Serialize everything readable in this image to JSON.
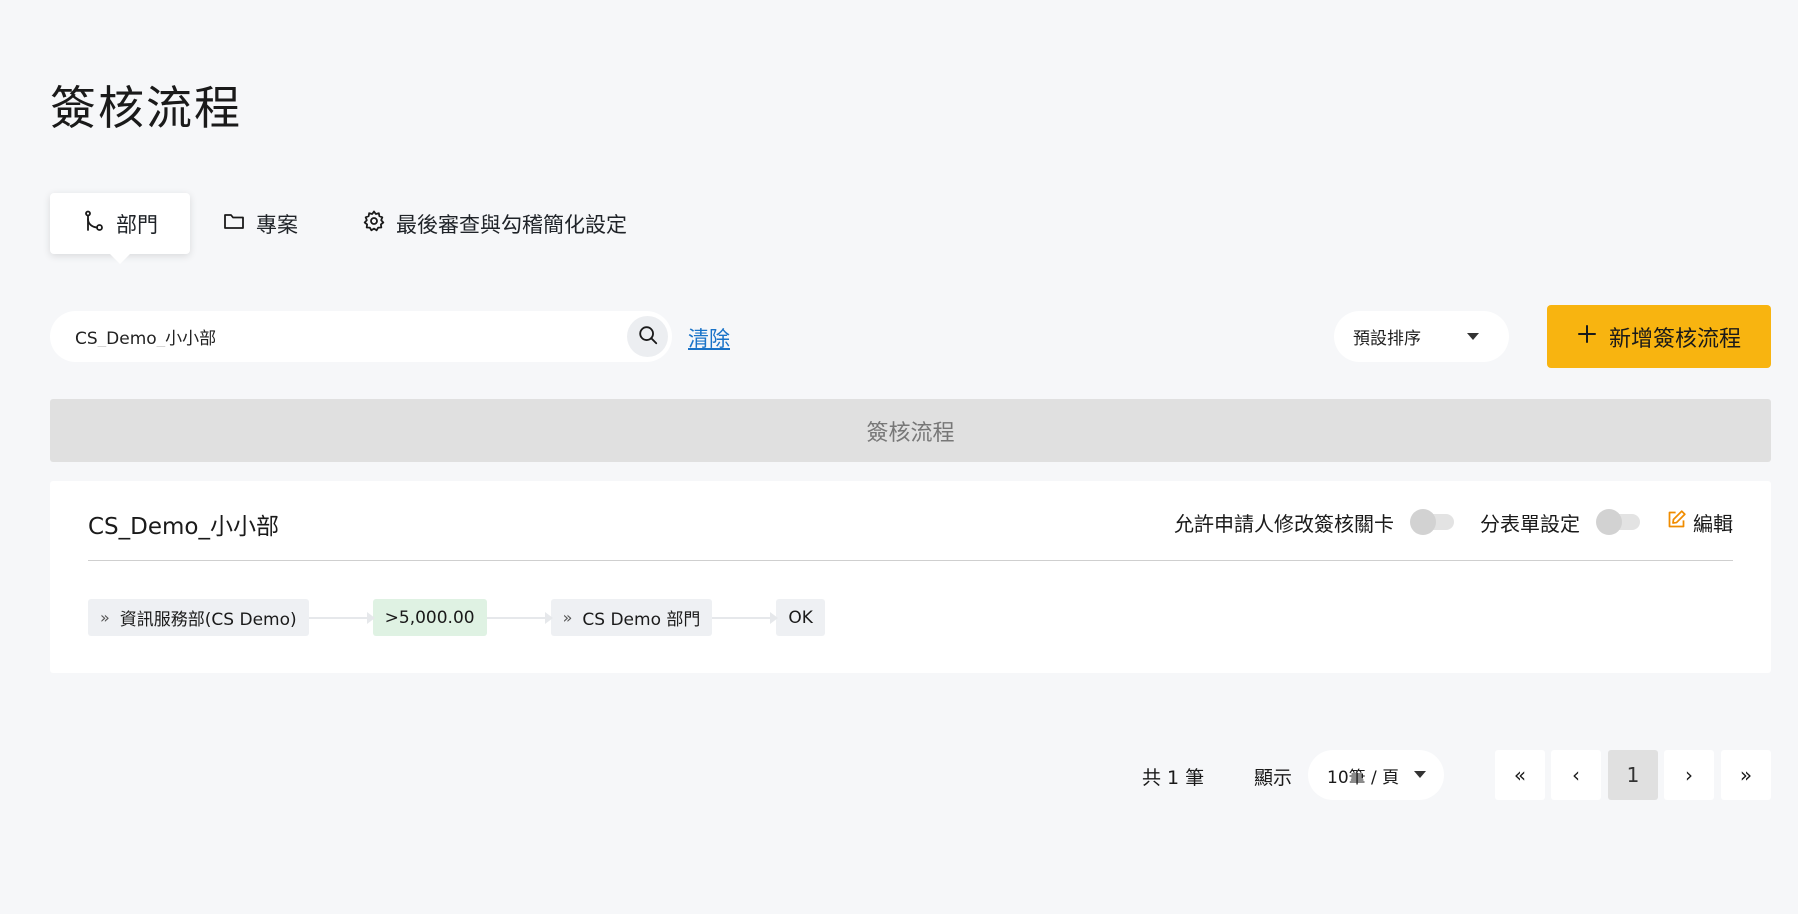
{
  "page": {
    "title": "簽核流程"
  },
  "tabs": [
    {
      "label": "部門",
      "icon": "branch-icon",
      "active": true
    },
    {
      "label": "專案",
      "icon": "folder-icon",
      "active": false
    },
    {
      "label": "最後審查與勾稽簡化設定",
      "icon": "gear-icon",
      "active": false
    }
  ],
  "search": {
    "value": "CS_Demo_小小部",
    "placeholder": "",
    "clear_label": "清除"
  },
  "sort": {
    "selected": "預設排序"
  },
  "toolbar": {
    "add_label": "新增簽核流程",
    "accent": "#f8b410"
  },
  "list": {
    "header": "簽核流程"
  },
  "card": {
    "title": "CS_Demo_小小部",
    "allow_edit_label": "允許申請人修改簽核關卡",
    "split_form_label": "分表單設定",
    "edit_label": "編輯",
    "flow": [
      {
        "type": "dept",
        "label": "資訊服務部(CS Demo)"
      },
      {
        "type": "condition",
        "label": ">5,000.00"
      },
      {
        "type": "dept",
        "label": "CS Demo 部門"
      },
      {
        "type": "end",
        "label": "OK"
      }
    ]
  },
  "pagination": {
    "total": "共 1 筆",
    "show_label": "顯示",
    "page_size": "10筆 / 頁",
    "first": "«",
    "prev": "‹",
    "current": "1",
    "next": "›",
    "last": "»"
  }
}
